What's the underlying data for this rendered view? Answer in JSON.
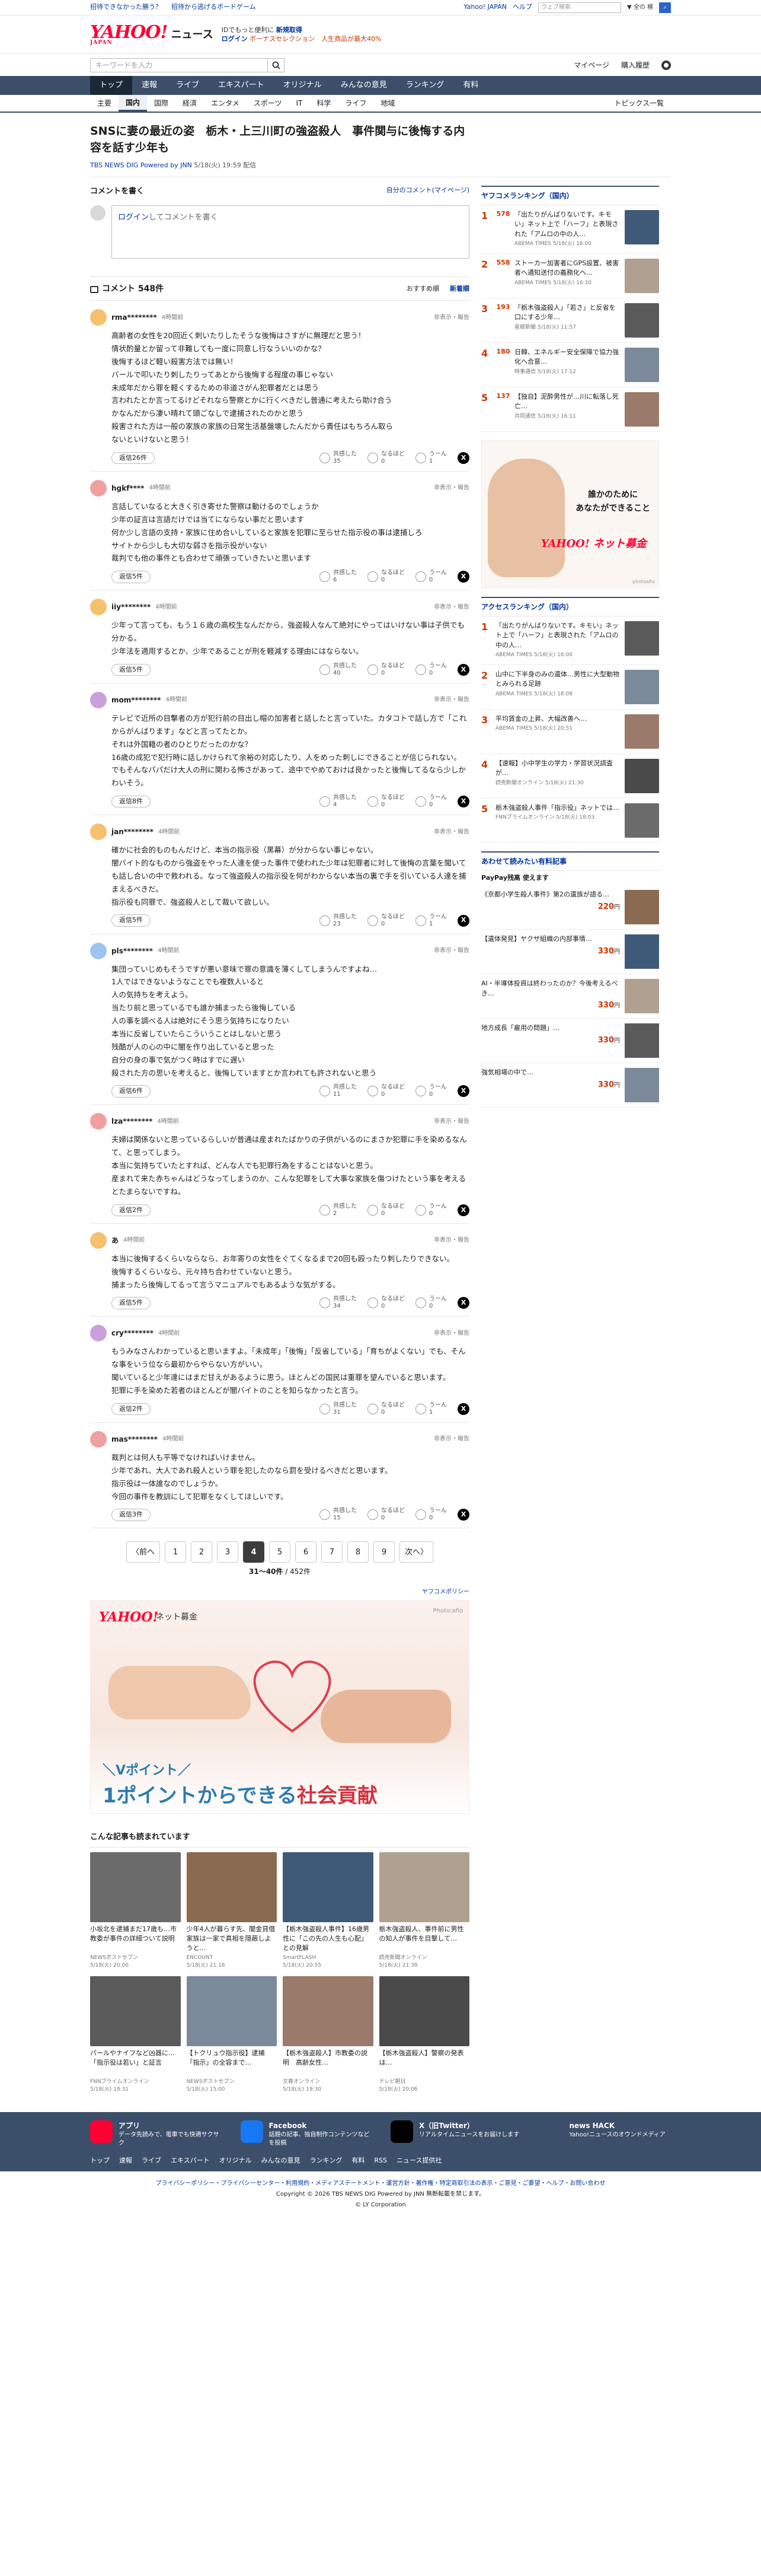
{
  "topstrip": {
    "left": [
      "招待できなかった勝う？",
      "招待から逃げるボードゲーム"
    ],
    "right": [
      "Yahoo! JAPAN",
      "ヘルプ"
    ],
    "search_placeholder": "ウェブ検索",
    "search_select": "▼ 全の 検"
  },
  "header": {
    "logo": "YAHOO!",
    "logo_sub": "JAPAN",
    "service": "ニュース",
    "promo_a": "IDでもっと便利に",
    "promo_b": "新規取得",
    "promo_login": "ログイン",
    "promo_c": "ボーナスセレクション　人生商品が最大40%"
  },
  "search": {
    "placeholder": "キーワードを入力",
    "links": [
      "マイページ",
      "購入履歴"
    ]
  },
  "gnav": [
    "トップ",
    "速報",
    "ライブ",
    "エキスパート",
    "オリジナル",
    "みんなの意見",
    "ランキング",
    "有料"
  ],
  "snav": [
    "主要",
    "国内",
    "国際",
    "経済",
    "エンタメ",
    "スポーツ",
    "IT",
    "科学",
    "ライフ",
    "地域"
  ],
  "snav_more": "トピックス一覧",
  "article": {
    "title": "SNSに妻の最近の姿　栃木・上三川町の強盗殺人　事件関与に後悔する内容を話す少年も",
    "source": "TBS NEWS DIG Powered by JNN",
    "date": "5/18(火) 19:59 配信"
  },
  "comments_box": {
    "title": "コメントを書く",
    "mine": "自分のコメント(マイページ)",
    "login_link": "ログイン",
    "login_text": "してコメントを書く"
  },
  "comments_list": {
    "count": "コメント 548件",
    "sort_recommended": "おすすめ順",
    "sort_new": "新着順"
  },
  "comments": [
    {
      "user": "rma********",
      "time": "4時間前",
      "report": "非表示・報告",
      "body": "高齢者の女性を20回近く刺いたりしたそうな後悔はさすがに無理だと思う！\n情状酌量とか留って非難しても一度に同意し行なういいのかな？\n後悔するほど軽い殺害方法では無い！\nバールで叩いたり刺したりってあとから後悔する程度の事じゃない\n未成年だから罪を軽くするための非道さがん犯罪者だとは思う\n言われたとか言ってるけどそれなら警察とかに行くべきだし普通に考えたら助け合う\nかなんだから凄い晴れて頭ごなしで逮捕されたのかと思う\n殺害された方は一般の家族の家族の日常生活基盤壊したんだから責任はもちろん取ら\nないといけないと思う！",
      "replies": "返信26件",
      "agree": "35",
      "good": "0",
      "hmm": "1"
    },
    {
      "user": "hgkf****",
      "time": "4時間前",
      "report": "非表示・報告",
      "body": "言話していなると大きく引き寄せた警察は動けるのでしょうか\n少年の証言は言語だけでは当てにならない事だと思います\n何か少し言語の支持・家族に住め合いしていると家族を犯罪に至らせた指示役の事は逮捕しろ\nサイトから少しも大切な弱さを指示役がいない\n裁判でも他の事件とも合わせて頑張っていきたいと思います",
      "replies": "返信5件",
      "agree": "6",
      "good": "0",
      "hmm": "0"
    },
    {
      "user": "iiy********",
      "time": "4時間前",
      "report": "非表示・報告",
      "body": "少年って言っても、もう１６歳の高校生なんだから、強盗殺人なんて絶対にやってはいけない事は子供でも分かる。\n少年法を適用するとか、少年であることが刑を軽減する理由にはならない。",
      "replies": "返信5件",
      "agree": "40",
      "good": "0",
      "hmm": "0"
    },
    {
      "user": "mom********",
      "time": "4時間前",
      "report": "非表示・報告",
      "body": "テレビで近所の目撃者の方が犯行前の目出し帽の加害者と話したと言っていた。カタコトで話し方で「これからがんばります」などと言ってたとか。\nそれは外国籍の者のひとりだったのかな？\n16歳の成犯で犯行時に話しかけられて余裕の対応したり、人をめった刺しにできることが信じられない。\nでもそんなパパだけ大人の刑に関わる怖さがあって、途中でやめておけば良かったと後悔してるなら少しかわいそう。",
      "replies": "返信8件",
      "agree": "4",
      "good": "0",
      "hmm": "0"
    },
    {
      "user": "jan********",
      "time": "4時間前",
      "report": "非表示・報告",
      "body": "確かに社会的ものもんだけど、本当の指示役（黒幕）が分からない事じゃない。\n闇バイト的なものから強盗をやった人達を使った事件で使われた少年は犯罪者に対して後悔の言葉を聞いても話し合いの中で救われる。なって強盗殺人の指示役を何がわからない本当の裏で手を引いている人達を捕まえるべきだ。\n指示役も同罪で、強盗殺人として裁いて欲しい。",
      "replies": "返信5件",
      "agree": "23",
      "good": "0",
      "hmm": "1"
    },
    {
      "user": "pls********",
      "time": "4時間前",
      "report": "非表示・報告",
      "body": "集団っていじめもそうですが悪い意味で罪の意識を薄くしてしまうんですよね…\n1人ではできないようなことでも複数人いると\n人の気持ちを考えよう。\n当たり前と思っているでも誰か捕まったら後悔している\n人の事を調べる人は絶対にそう思う気持ちになりたい\n本当に反省していたらこういうことはしないと思う\n残酷が人の心の中に闇を作り出していると思った\n自分の身の事で気がつく時はすでに遅い\n殺された方の思いを考えると、後悔していますとか言われても許されないと思う",
      "replies": "返信6件",
      "agree": "11",
      "good": "0",
      "hmm": "0"
    },
    {
      "user": "lza********",
      "time": "4時間前",
      "report": "非表示・報告",
      "body": "夫婦は関係ないと思っているらしいが普通は産まれたばかりの子供がいるのにまさか犯罪に手を染めるなんて、と思ってしまう。\n本当に気持ちていたとすれば、どんな人でも犯罪行為をすることはないと思う。\n産まれて来た赤ちゃんはどうなってしまうのか、こんな犯罪をして大事な家族を傷つけたという事を考えるとたまらないですね。",
      "replies": "返信2件",
      "agree": "2",
      "good": "0",
      "hmm": "0"
    },
    {
      "user": "あ",
      "time": "4時間前",
      "report": "非表示・報告",
      "body": "本当に後悔するくらいならなら、お年寄りの女性をぐてくなるまで20回も殴ったり刺したりできない。\n後悔するくらいなら、元々持ち合わせていないと思う。\n捕まったら後悔してるって言うマニュアルでもあるような気がする。",
      "replies": "返信5件",
      "agree": "34",
      "good": "0",
      "hmm": "0"
    },
    {
      "user": "cry********",
      "time": "4時間前",
      "report": "非表示・報告",
      "body": "もうみなさんわかっていると思いますよ。「未成年」「後悔」「反省している」「育ちがよくない」でも、そんな事をいう位なら最初からやらない方がいい。\n聞いていると少年達にはまだ甘えがあるように思う。ほとんどの国民は重罪を望んでいると思います。\n犯罪に手を染めた若者のほとんどが闇バイトのことを知らなかったと言う。",
      "replies": "返信2件",
      "agree": "31",
      "good": "0",
      "hmm": "1"
    },
    {
      "user": "mas********",
      "time": "4時間前",
      "report": "非表示・報告",
      "body": "裁判とは何人も平等でなければいけません。\n少年であれ、大人であれ殺人という罪を犯したのなら罰を受けるべきだと思います。\n指示役は一体誰なのでしょうか。\n今回の事件を教訓にして犯罪をなくしてほしいです。",
      "replies": "返信3件",
      "agree": "15",
      "good": "0",
      "hmm": "0"
    }
  ],
  "vote_labels": {
    "agree": "共感した",
    "good": "なるほど",
    "hmm": "うーん"
  },
  "pager": {
    "prev": "〈前へ",
    "next": "次へ〉",
    "pages": [
      "1",
      "2",
      "3",
      "4",
      "5",
      "6",
      "7",
      "8",
      "9"
    ],
    "current": "4",
    "range": "31〜40件",
    "total": "/ 452件"
  },
  "ad_policy": "ヤフコメポリシー",
  "bigad": {
    "logo": "YAHOO!",
    "logo_sub": "ネット募金",
    "photo": "Photo:afio",
    "line1": "＼Vポイント／",
    "line2a": "1ポイントからできる",
    "line2b": "社会貢献"
  },
  "recs": {
    "title": "こんな記事も読まれています",
    "items": [
      {
        "title": "小坂北を逮捕まだ17歳も…市教委が事件の詳細ついて説明",
        "meta": "NEWSポストセブン\n5/18(火) 20:00"
      },
      {
        "title": "少年4人が暮らす先、闇金貸借家族は一家で真相を隠蔽しようと…",
        "meta": "ENCOUNT\n5/18(火) 21:18"
      },
      {
        "title": "【栃木強盗殺人事件】16歳男性に「この先の人生も心配」との見解",
        "meta": "SmartFLASH\n5/18(火) 20:55"
      },
      {
        "title": "栃木強盗殺人、事件前に男性の知人が事件を目撃して…",
        "meta": "読売新聞オンライン\n5/18(火) 21:38"
      },
      {
        "title": "パールやナイフなど凶器に…「指示役は若い」と証言",
        "meta": "FNNプライムオンライン\n5/18(火) 18:31"
      },
      {
        "title": "【トクリュウ指示役】逮捕「指示」の全容まで…",
        "meta": "NEWSポストセブン\n5/18(火) 15:00"
      },
      {
        "title": "【栃木強盗殺人】市教委の説明　高齢女性…",
        "meta": "文春オンライン\n5/18(火) 19:30"
      },
      {
        "title": "【栃木強盗殺人】警察の発表は…",
        "meta": "テレビ朝日\n5/18(火) 20:06"
      }
    ]
  },
  "side": {
    "rank1_title": "ヤフコメランキング（国内）",
    "rank1": [
      {
        "n": "1",
        "c": "578",
        "t": "「出たりがんばりないです。キモい」ネット上で「ハーフ」と表現された「アムロの中の人…",
        "m": "ABEMA TIMES 5/18(火) 16:00"
      },
      {
        "n": "2",
        "c": "558",
        "t": "ストーカー加害者にGPS設置、被害者へ通知送付の義務化へ…",
        "m": "ABEMA TIMES 5/18(火) 16:30"
      },
      {
        "n": "3",
        "c": "193",
        "t": "「栃木強盗殺人」「若さ」と反省を口にする少年…",
        "m": "産経新聞 5/18(火) 11:57"
      },
      {
        "n": "4",
        "c": "180",
        "t": "日韓、エネルギー安全保障で協力強化へ合意…",
        "m": "時事通信 5/18(火) 17:12"
      },
      {
        "n": "5",
        "c": "137",
        "t": "【独自】泥酔男性が…川に転落し死亡…",
        "m": "共同通信 5/18(火) 16:11"
      }
    ],
    "sidead": {
      "line1": "誰かのために\nあなたができること",
      "logo": "YAHOO! ネット募金",
      "photo": "photoafio"
    },
    "rank2_title": "アクセスランキング（国内）",
    "rank2": [
      {
        "n": "1",
        "t": "「出たりがんばりないです。キモい」ネット上で「ハーフ」と表現された「アムロの中の人…",
        "m": "ABEMA TIMES 5/18(火) 16:00"
      },
      {
        "n": "2",
        "t": "山中に下半身のみの遺体…男性に大型動物とみられる足跡",
        "m": "ABEMA TIMES 5/18(火) 18:08"
      },
      {
        "n": "3",
        "t": "平均賃金の上昇、大幅改善へ…",
        "m": "ABEMA TIMES 5/18(火) 20:51"
      },
      {
        "n": "4",
        "t": "【速報】小中学生の学力・学習状況調査が…",
        "m": "読売新聞オンライン 5/18(火) 21:30"
      },
      {
        "n": "5",
        "t": "栃木強盗殺人事件「指示役」ネットでは…",
        "m": "FNNプライムオンライン 5/18(火) 18:03"
      }
    ],
    "paid_title": "あわせて読みたい有料記事",
    "paypay": "PayPay残高 使えます",
    "prods": [
      {
        "t": "《京都小学生殺人事件》第2の遺族が語る…",
        "p": "220",
        "u": "円"
      },
      {
        "t": "【遺体発見】ヤクザ組織の内部事情…",
        "p": "330",
        "u": "円"
      },
      {
        "t": "AI・半導体投資は終わったのか？今後考えるべき…",
        "p": "330",
        "u": "円"
      },
      {
        "t": "地方成長「雇用の問題」…",
        "p": "330",
        "u": "円"
      },
      {
        "t": "強気相場の中で…",
        "p": "330",
        "u": "円"
      }
    ]
  },
  "footer": {
    "apps": [
      {
        "t": "アプリ",
        "d": "データ先読みで、電車でも快適サクサク"
      },
      {
        "t": "Facebook",
        "d": "話題の記事、独自制作コンテンツなどを投稿"
      },
      {
        "t": "X（旧Twitter）",
        "d": "リアルタイムニュースをお届けします"
      },
      {
        "t": "news HACK",
        "d": "Yahoo!ニュースのオウンドメディア"
      }
    ],
    "nav": [
      "トップ",
      "速報",
      "ライブ",
      "エキスパート",
      "オリジナル",
      "みんなの意見",
      "ランキング",
      "有料",
      "RSS",
      "ニュース提供社"
    ],
    "links": "プライバシーポリシー・プライバシーセンター・利用規約・メディアステートメント・運営方針・著作権・特定商取引法の表示・ご意見・ご要望・ヘルプ・お問い合わせ",
    "copy1": "Copyright © 2026 TBS NEWS DIG Powered by JNN 無断転載を禁じます。",
    "copy2": "© LY Corporation"
  }
}
